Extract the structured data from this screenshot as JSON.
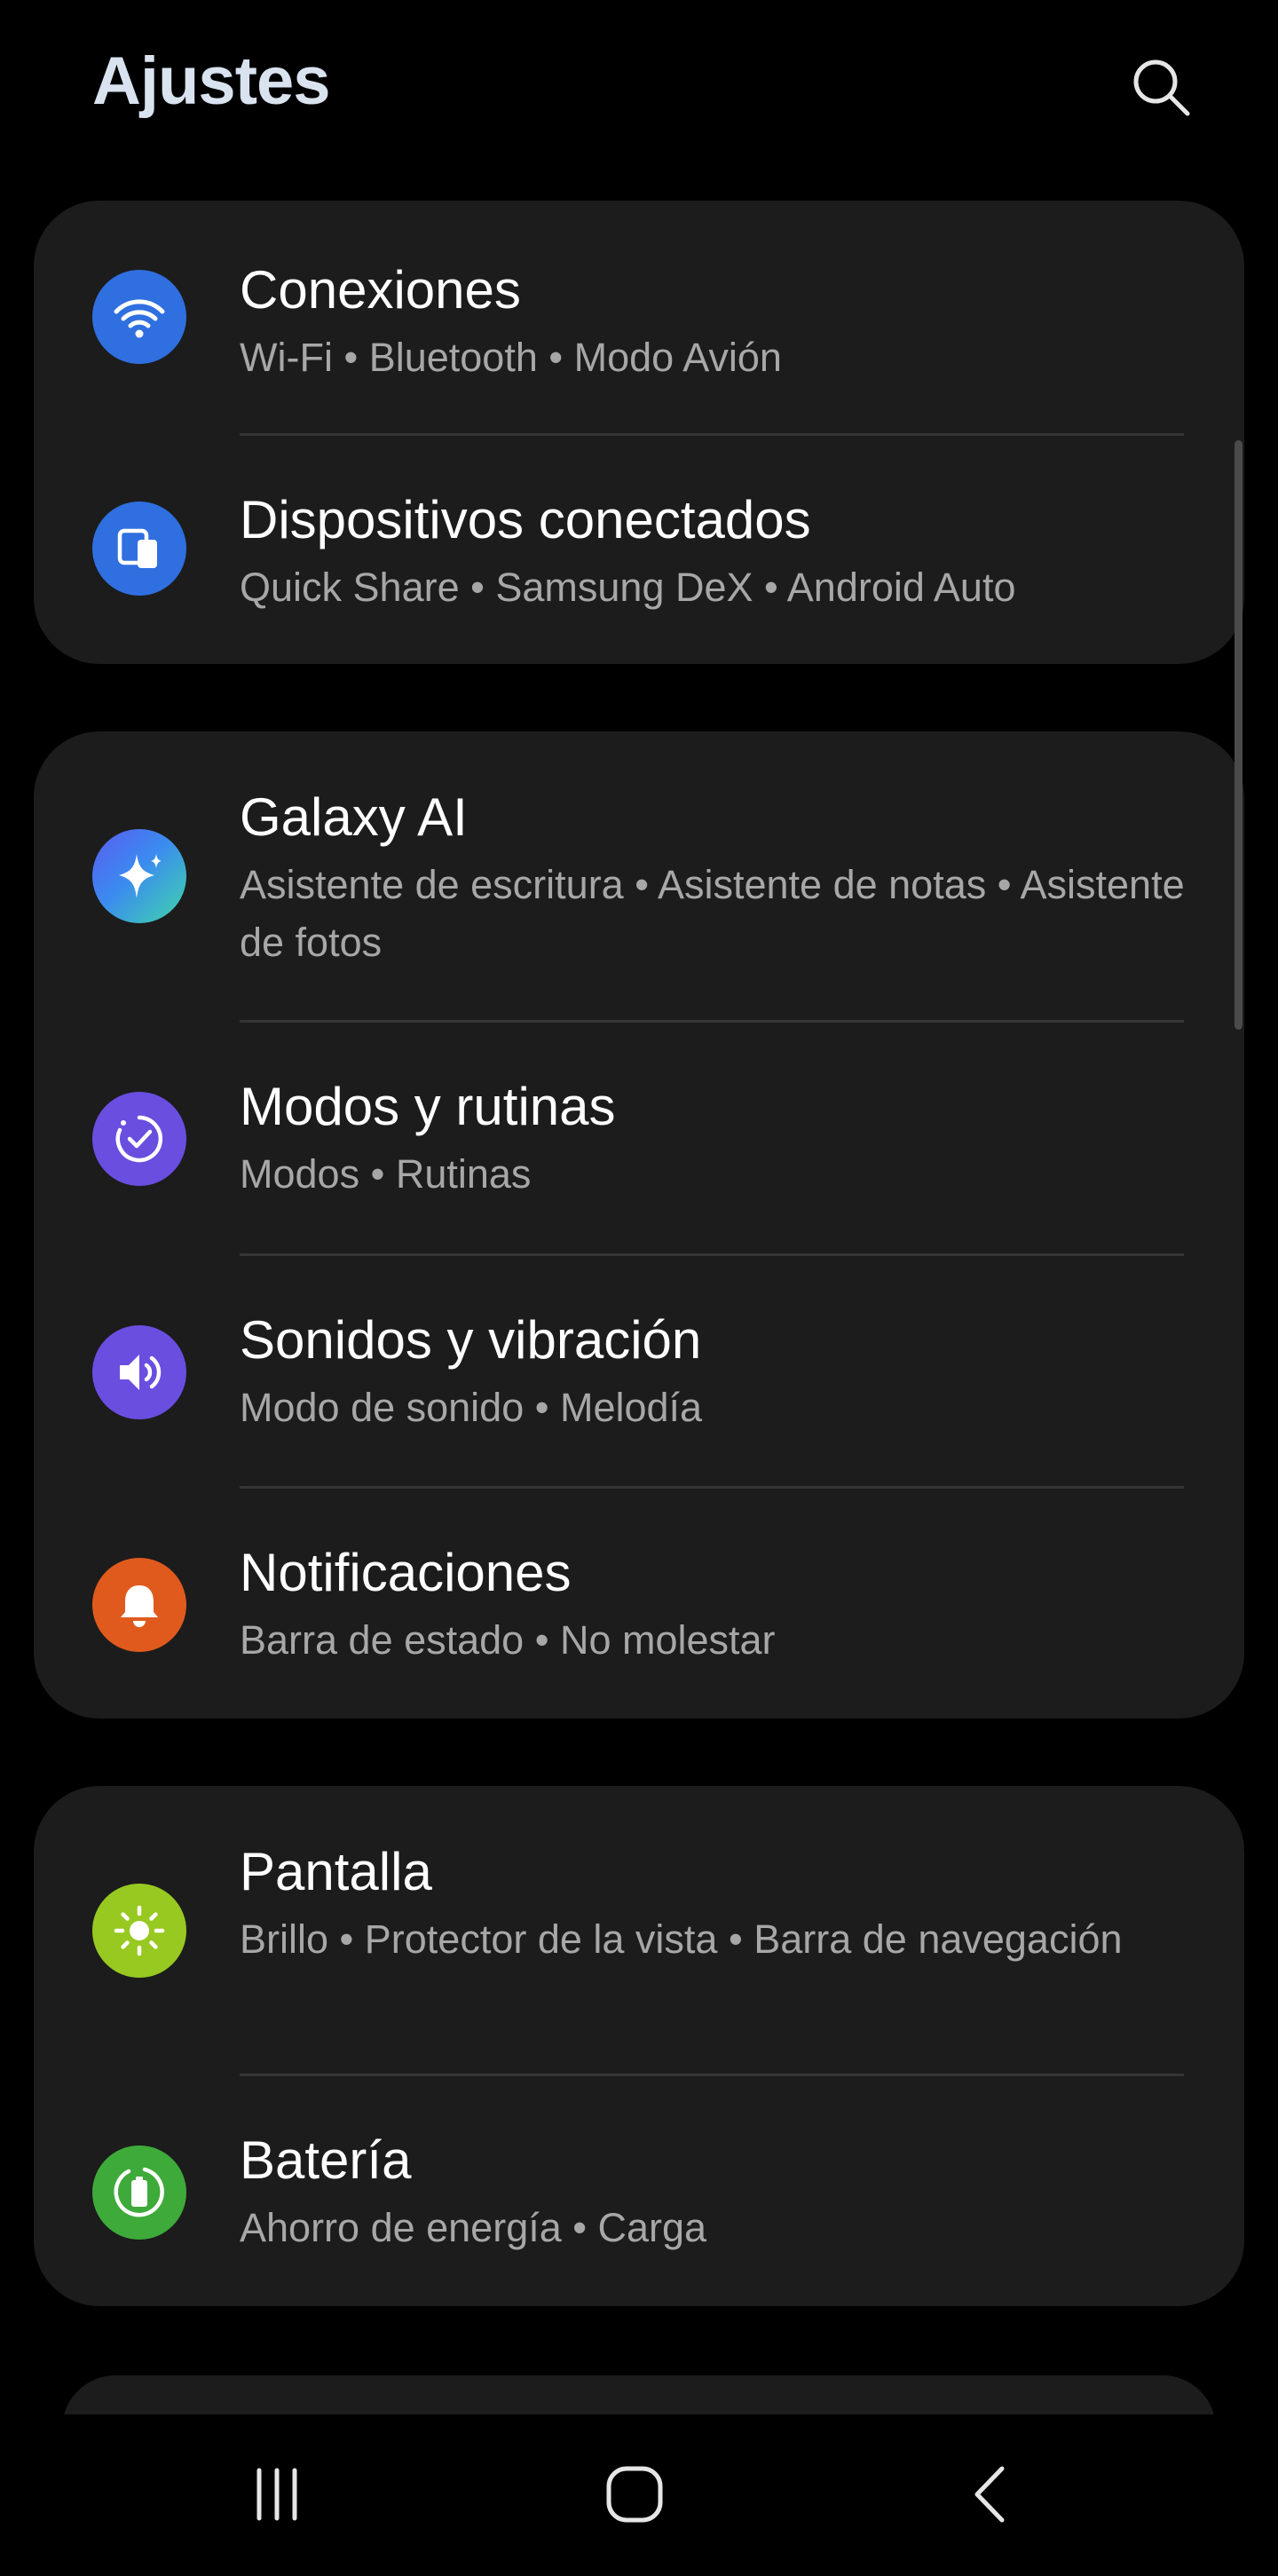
{
  "header": {
    "title": "Ajustes",
    "search_icon": "search-icon"
  },
  "colors": {
    "background": "#000000",
    "card": "#1c1c1c",
    "title_text": "#d9e3ef",
    "subtitle_text": "#a7a7a7",
    "blue": "#2f6fe0",
    "purple": "#6a4ee0",
    "orange": "#e05a1e",
    "lime": "#97c921",
    "green": "#3eaa3a"
  },
  "groups": [
    {
      "items": [
        {
          "title": "Conexiones",
          "subtitle": "Wi-Fi  •  Bluetooth  •  Modo Avión",
          "icon": "wifi-icon"
        },
        {
          "title": "Dispositivos conectados",
          "subtitle": "Quick Share  •  Samsung DeX  •  Android Auto",
          "icon": "connected-devices-icon"
        }
      ]
    },
    {
      "items": [
        {
          "title": "Galaxy AI",
          "subtitle": "Asistente de escritura  •  Asistente de notas  •  Asistente de fotos",
          "icon": "sparkle-icon"
        },
        {
          "title": "Modos y rutinas",
          "subtitle": "Modos  •  Rutinas",
          "icon": "modes-check-icon"
        },
        {
          "title": "Sonidos y vibración",
          "subtitle": "Modo de sonido  •  Melodía",
          "icon": "speaker-icon"
        },
        {
          "title": "Notificaciones",
          "subtitle": "Barra de estado  •  No molestar",
          "icon": "bell-icon"
        }
      ]
    },
    {
      "items": [
        {
          "title": "Pantalla",
          "subtitle": "Brillo  •  Protector de la vista  •  Barra de navegación",
          "icon": "sun-icon"
        },
        {
          "title": "Batería",
          "subtitle": "Ahorro de energía  •  Carga",
          "icon": "battery-icon"
        }
      ]
    }
  ],
  "navbar": {
    "recents_icon": "recents-icon",
    "home_icon": "home-icon",
    "back_icon": "back-icon"
  }
}
